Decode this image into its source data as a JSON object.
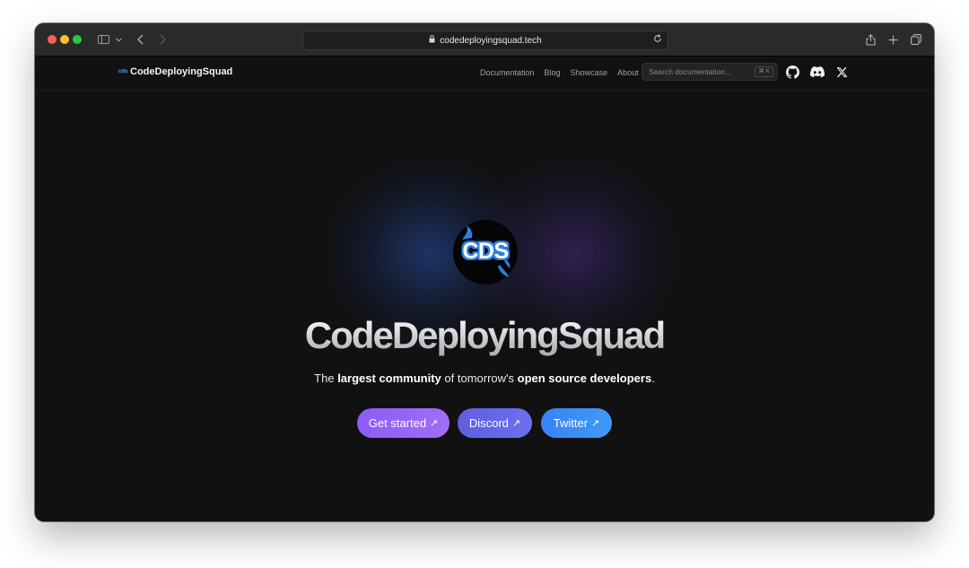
{
  "browser": {
    "url": "codedeployingsquad.tech",
    "icons": {
      "sidebar": "sidebar-icon",
      "chevron": "chevron-down-icon",
      "back": "back-arrow-icon",
      "forward": "forward-arrow-icon",
      "lock": "lock-icon",
      "reload": "reload-icon",
      "share": "share-icon",
      "new_tab": "plus-icon",
      "tabs": "tabs-overview-icon"
    }
  },
  "nav": {
    "brand": "CodeDeployingSquad",
    "brand_mark": "cds",
    "links": [
      "Documentation",
      "Blog",
      "Showcase",
      "About"
    ],
    "search_placeholder": "Search documentation...",
    "search_shortcut": "⌘ K",
    "social_icons": [
      "github-icon",
      "discord-icon",
      "x-icon"
    ]
  },
  "hero": {
    "logo_text": "CDS",
    "title": "CodeDeployingSquad",
    "tagline": {
      "p1": "The ",
      "b1": "largest community",
      "p2": " of tomorrow's ",
      "b2": "open source developers",
      "p3": "."
    },
    "buttons": [
      {
        "label": "Get started",
        "arrow": "↗"
      },
      {
        "label": "Discord",
        "arrow": "↗"
      },
      {
        "label": "Twitter",
        "arrow": "↗"
      }
    ]
  },
  "colors": {
    "background": "#111112",
    "toolbar": "#2a2a2c",
    "get_started": "#8b5cf6",
    "discord": "#6366f1",
    "twitter": "#3b82f6",
    "logo_accent": "#2f7fe0"
  }
}
